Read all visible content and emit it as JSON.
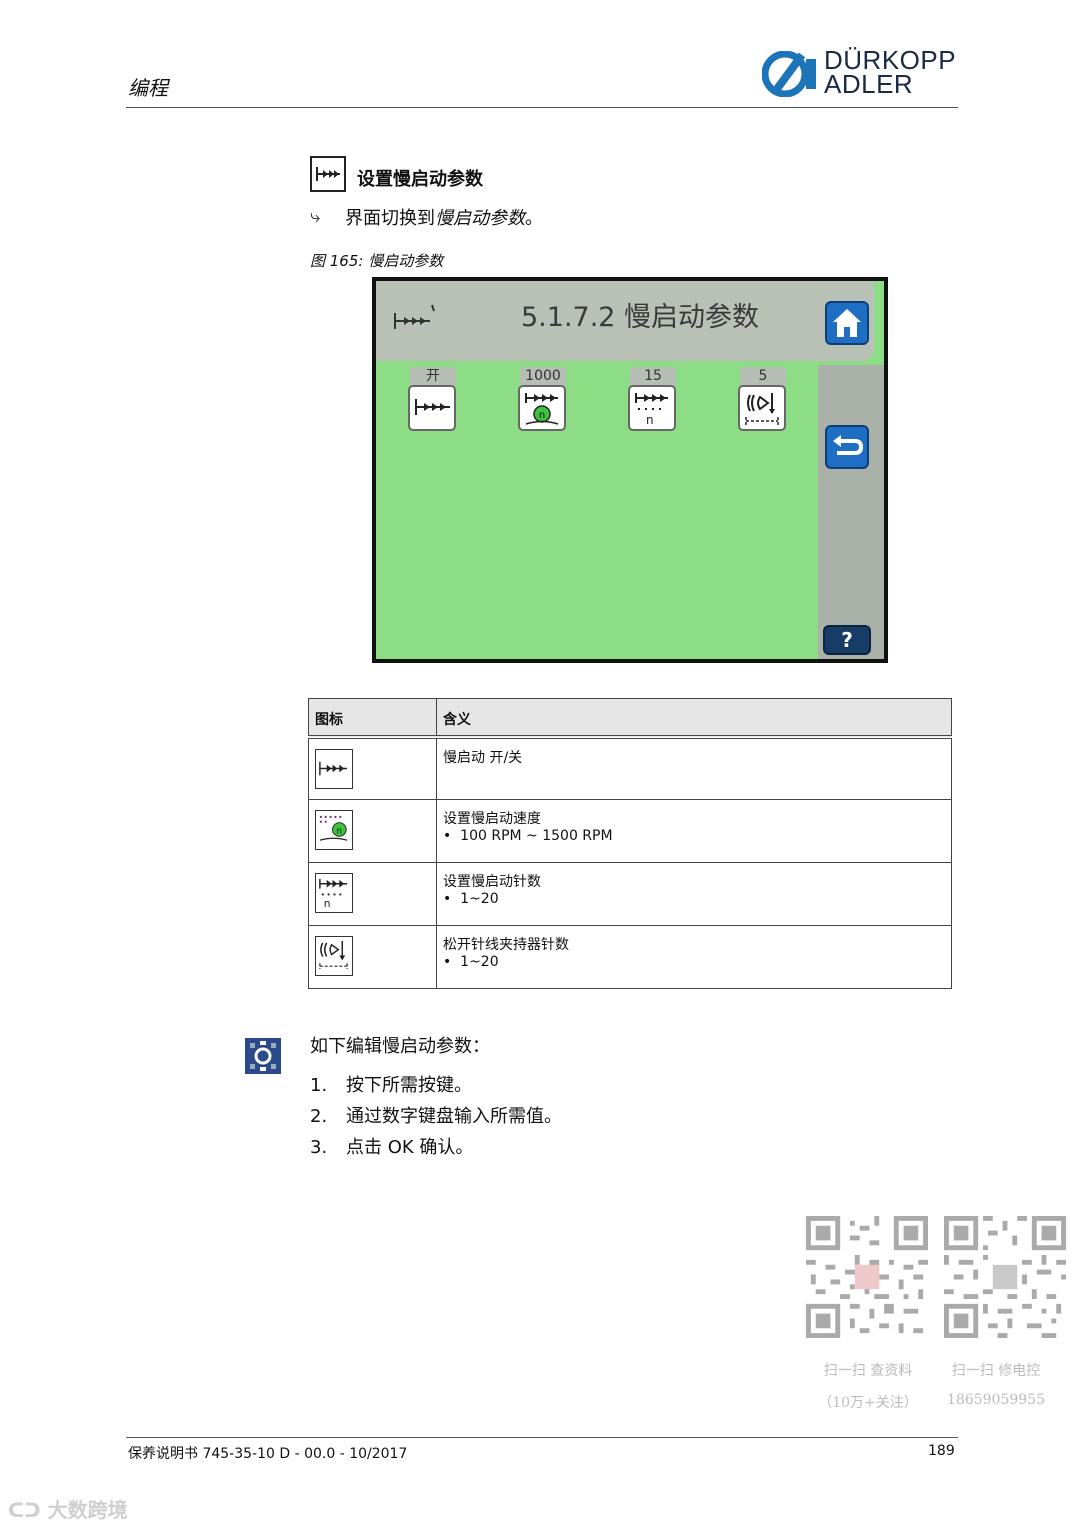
{
  "header": {
    "title": "编程",
    "brand_line1": "DÜRKOPP",
    "brand_line2": "ADLER"
  },
  "section": {
    "heading": "设置慢启动参数",
    "result_prefix": "界面切换到",
    "result_italic": "慢启动参数",
    "result_suffix": "。",
    "figure_caption": "图 165: 慢启动参数"
  },
  "screen": {
    "title": "5.1.7.2 慢启动参数",
    "params": [
      {
        "value": "开"
      },
      {
        "value": "1000"
      },
      {
        "value": "15",
        "icon_label": "n"
      },
      {
        "value": "5"
      }
    ],
    "help_label": "?",
    "background_color": "#8cdd85"
  },
  "table": {
    "headers": [
      "图标",
      "含义"
    ],
    "rows": [
      {
        "title": "慢启动 开/关",
        "bullet": ""
      },
      {
        "title": "设置慢启动速度",
        "bullet": "100 RPM ~ 1500 RPM"
      },
      {
        "title": "设置慢启动针数",
        "bullet": "1~20",
        "icon_label": "n"
      },
      {
        "title": "松开针线夹持器针数",
        "bullet": "1~20"
      }
    ]
  },
  "procedure": {
    "intro": "如下编辑慢启动参数：",
    "steps": [
      {
        "num": "1.",
        "text": "按下所需按键。"
      },
      {
        "num": "2.",
        "text": "通过数字键盘输入所需值。"
      },
      {
        "num": "3.",
        "text": "点击 OK 确认。"
      }
    ]
  },
  "qr": {
    "caption1_line1": "扫一扫 查资料",
    "caption1_line2": "（10万+关注）",
    "caption2_line1": "扫一扫 修电控",
    "caption2_line2": "18659059955"
  },
  "footer": {
    "left": "保养说明书 745-35-10 D - 00.0 - 10/2017",
    "page": "189"
  },
  "watermark": "大数跨境"
}
